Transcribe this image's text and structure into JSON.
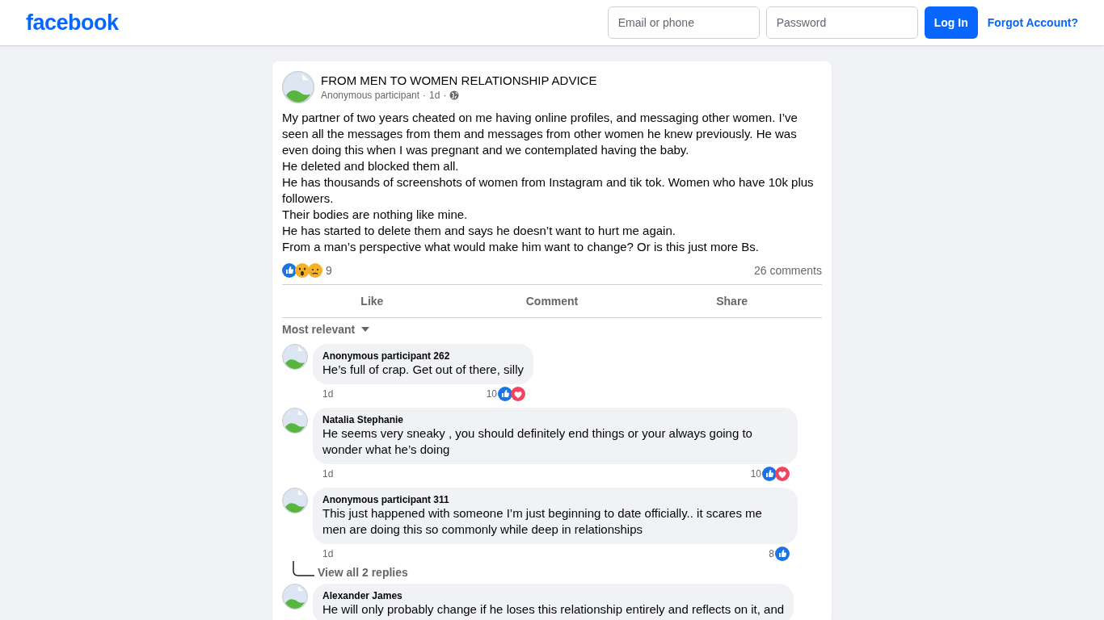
{
  "header": {
    "logo": "facebook",
    "email": {
      "placeholder": "Email or phone"
    },
    "password": {
      "placeholder": "Password"
    },
    "login_button": "Log In",
    "forgot_link": "Forgot Account?"
  },
  "post": {
    "group": "FROM MEN TO WOMEN RELATIONSHIP ADVICE",
    "author": "Anonymous participant",
    "time": "1d",
    "separator": "·",
    "paragraphs": [
      "My partner of two years cheated on me having online profiles, and messaging other women. I’ve seen all the messages from them and messages from other women he knew previously. He was even doing this when I was pregnant and we contemplated having the baby.",
      "He deleted and blocked them all.",
      "He has thousands of screenshots of women from Instagram and tik tok. Women who have 10k plus followers.",
      "Their bodies are nothing like mine.",
      "He has started to delete them and says he doesn’t want to hurt me again.",
      "From a man’s perspective what would make him want to change? Or is this just more Bs."
    ],
    "reactions": [
      {
        "kind": "like"
      },
      {
        "kind": "wow"
      },
      {
        "kind": "sad"
      }
    ],
    "reaction_count": "9",
    "comment_count": "26 comments",
    "actions": [
      "Like",
      "Comment",
      "Share"
    ]
  },
  "sort": "Most relevant",
  "comments": [
    {
      "author": "Anonymous participant 262",
      "text": "He’s full of crap. Get out of there, silly",
      "time": "1d",
      "reaction_count": "10",
      "reactions": [
        {
          "kind": "like"
        },
        {
          "kind": "love"
        }
      ]
    },
    {
      "author": "Natalia Stephanie",
      "text": "He seems very sneaky , you should definitely end things or your always going to wonder what he’s doing",
      "time": "1d",
      "reaction_count": "10",
      "reactions": [
        {
          "kind": "like"
        },
        {
          "kind": "love"
        }
      ]
    },
    {
      "author": "Anonymous participant 311",
      "text": "This just happened with someone I’m just beginning to date officially.. it scares me men are doing this so commonly while deep in relationships",
      "time": "1d",
      "reaction_count": "8",
      "reactions": [
        {
          "kind": "like"
        }
      ],
      "replies_link": "View all 2 replies"
    },
    {
      "author": "Alexander James",
      "text": "He will only probably change if he loses this relationship entirely and reflects on it, and"
    }
  ]
}
